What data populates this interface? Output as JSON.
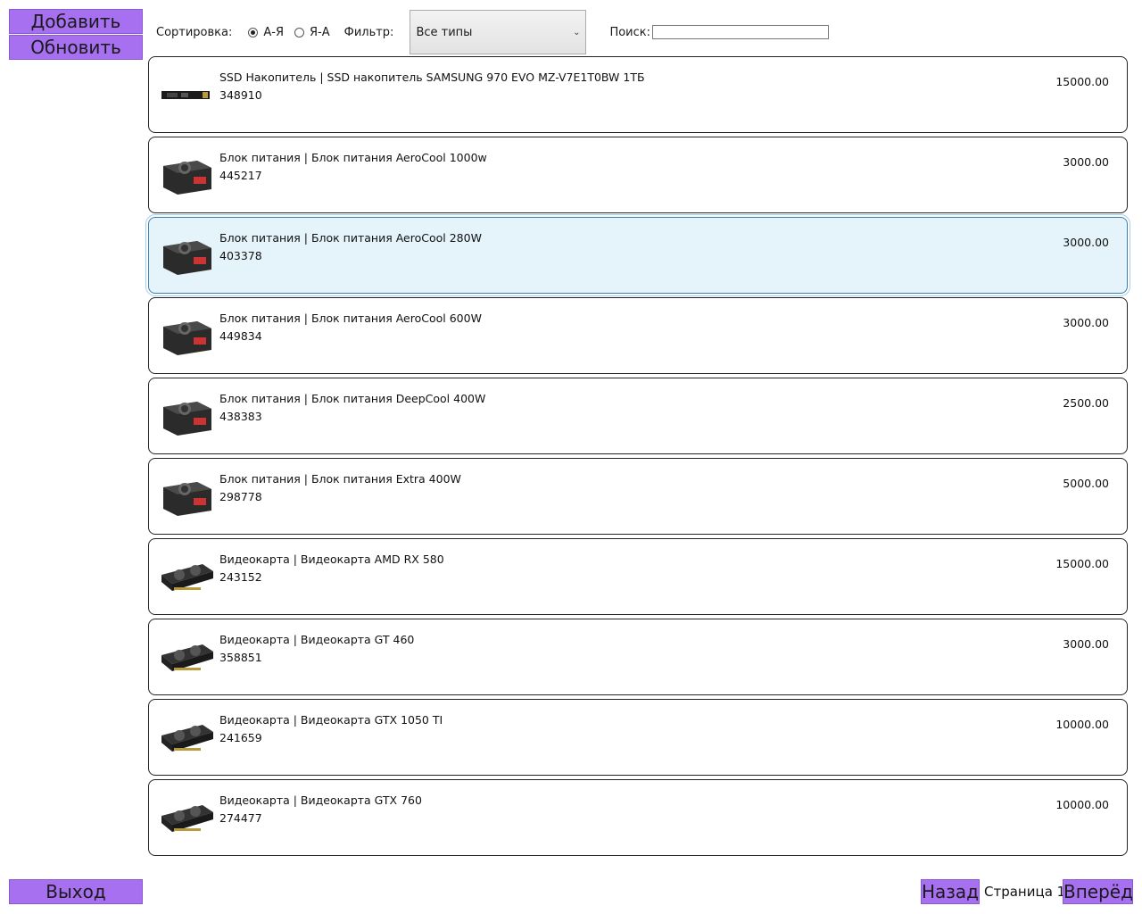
{
  "sidebar": {
    "add_label": "Добавить",
    "refresh_label": "Обновить",
    "exit_label": "Выход"
  },
  "toolbar": {
    "sort_label": "Сортировка:",
    "sort_options": [
      {
        "label": "А-Я",
        "checked": true
      },
      {
        "label": "Я-А",
        "checked": false
      }
    ],
    "filter_label": "Фильтр:",
    "filter_value": "Все типы",
    "search_label": "Поиск:",
    "search_value": ""
  },
  "products": [
    {
      "title": "SSD Накопитель | SSD накопитель SAMSUNG 970 EVO MZ-V7E1T0BW 1ТБ",
      "article": "348910",
      "price": "15000.00",
      "icon": "ssd-icon",
      "selected": false
    },
    {
      "title": "Блок питания | Блок питания AeroCool 1000w",
      "article": "445217",
      "price": "3000.00",
      "icon": "psu-icon",
      "selected": false
    },
    {
      "title": "Блок питания | Блок питания AeroCool 280W",
      "article": "403378",
      "price": "3000.00",
      "icon": "psu-icon",
      "selected": true
    },
    {
      "title": "Блок питания | Блок питания AeroCool 600W",
      "article": "449834",
      "price": "3000.00",
      "icon": "psu-icon",
      "selected": false
    },
    {
      "title": "Блок питания | Блок питания DeepCool 400W",
      "article": "438383",
      "price": "2500.00",
      "icon": "psu-icon",
      "selected": false
    },
    {
      "title": "Блок питания | Блок питания Extra 400W",
      "article": "298778",
      "price": "5000.00",
      "icon": "psu-icon",
      "selected": false
    },
    {
      "title": "Видеокарта | Видеокарта AMD RX 580",
      "article": "243152",
      "price": "15000.00",
      "icon": "gpu-icon",
      "selected": false
    },
    {
      "title": "Видеокарта | Видеокарта GT 460",
      "article": "358851",
      "price": "3000.00",
      "icon": "gpu-icon",
      "selected": false
    },
    {
      "title": "Видеокарта | Видеокарта GTX 1050 TI",
      "article": "241659",
      "price": "10000.00",
      "icon": "gpu-icon",
      "selected": false
    },
    {
      "title": "Видеокарта | Видеокарта GTX 760",
      "article": "274477",
      "price": "10000.00",
      "icon": "gpu-icon",
      "selected": false
    }
  ],
  "pager": {
    "back_label": "Назад",
    "page_label": "Страница 1",
    "next_label": "Вперёд"
  },
  "colors": {
    "button_bg": "#a670f0",
    "selected_bg": "#e5f3fb"
  }
}
